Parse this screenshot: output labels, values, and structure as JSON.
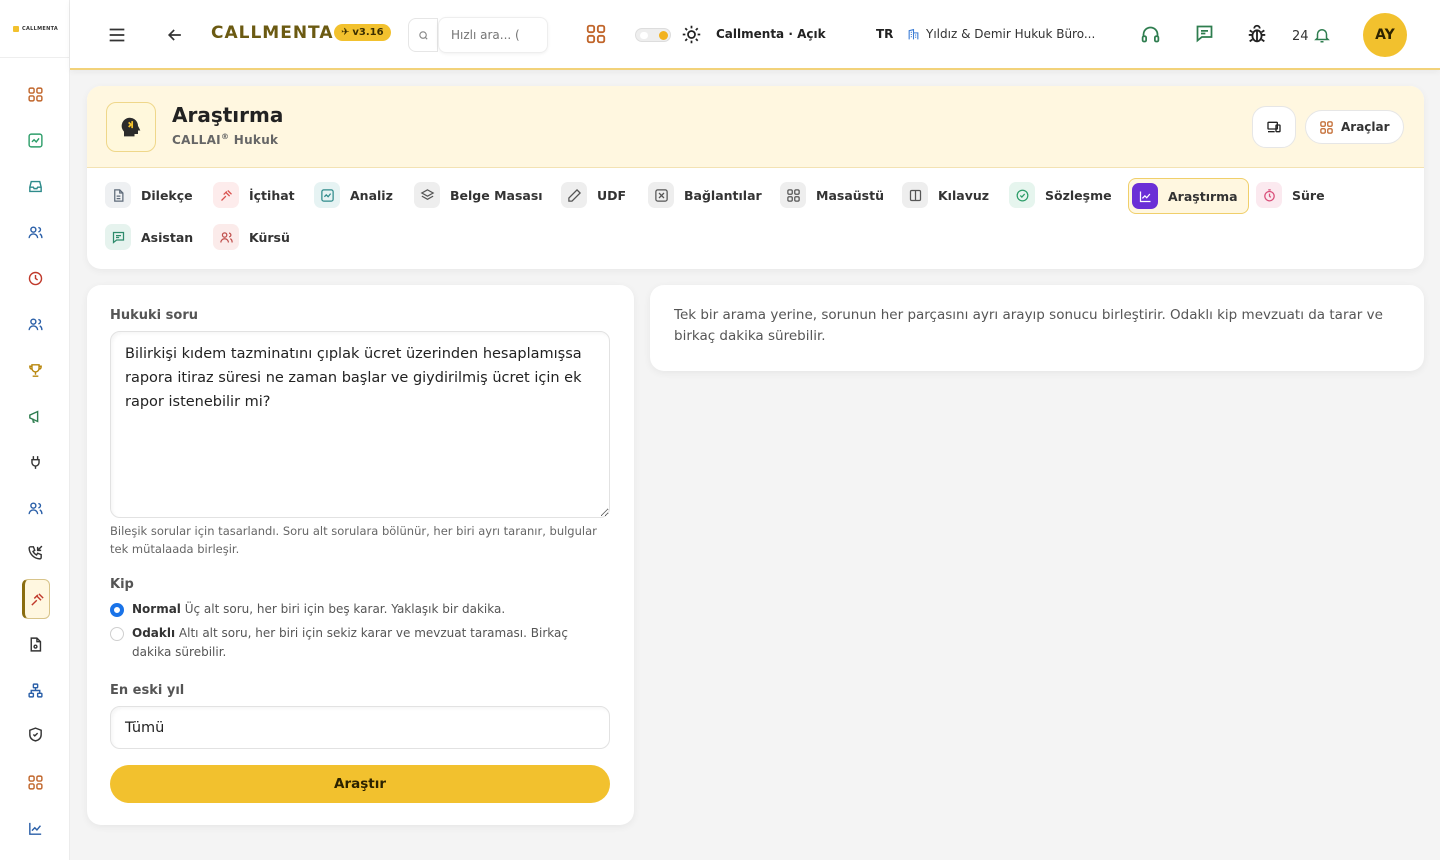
{
  "app": {
    "brand": "CALLMENTA",
    "version": "v3.16",
    "side_logo": "CALLMENTA"
  },
  "topbar": {
    "search_placeholder": "Hızlı ara... (",
    "status": "Callmenta · Açık",
    "lang": "TR",
    "firm": "Yıldız & Demir Hukuk Büro...",
    "notif_count": "24",
    "avatar": "AY"
  },
  "module": {
    "title": "Araştırma",
    "subtitle_prefix": "CALLAI",
    "subtitle_reg": "®",
    "subtitle_suffix": " Hukuk",
    "tools_label": "Araçlar"
  },
  "tabs": [
    {
      "label": "Dilekçe",
      "icon": "document-icon",
      "color": "#5f6b7a"
    },
    {
      "label": "İçtihat",
      "icon": "gavel-icon",
      "color": "#d9534f"
    },
    {
      "label": "Analiz",
      "icon": "analysis-icon",
      "color": "#2e8b8b"
    },
    {
      "label": "Belge Masası",
      "icon": "layers-icon",
      "color": "#555555"
    },
    {
      "label": "UDF",
      "icon": "pen-icon",
      "color": "#555555"
    },
    {
      "label": "Bağlantılar",
      "icon": "link-icon",
      "color": "#555555"
    },
    {
      "label": "Masaüstü",
      "icon": "grid-icon",
      "color": "#555555"
    },
    {
      "label": "Kılavuz",
      "icon": "book-icon",
      "color": "#555555"
    },
    {
      "label": "Sözleşme",
      "icon": "check-badge-icon",
      "color": "#2e9e6a"
    },
    {
      "label": "Araştırma",
      "icon": "chart-line-icon",
      "color": "#ffffff",
      "active": true
    },
    {
      "label": "Süre",
      "icon": "clock-icon",
      "color": "#d94f7a"
    },
    {
      "label": "Asistan",
      "icon": "chat-icon",
      "color": "#2e8b6b"
    },
    {
      "label": "Kürsü",
      "icon": "users-icon",
      "color": "#c0504d"
    }
  ],
  "form": {
    "question_label": "Hukuki soru",
    "question_value": "Bilirkişi kıdem tazminatını çıplak ücret üzerinden hesaplamışsa rapora itiraz süresi ne zaman başlar ve giydirilmiş ücret için ek rapor istenebilir mi?",
    "question_help": "Bileşik sorular için tasarlandı. Soru alt sorulara bölünür, her biri ayrı taranır, bulgular tek mütalaada birleşir.",
    "mode_label": "Kip",
    "modes": [
      {
        "name": "Normal",
        "desc": " Üç alt soru, her biri için beş karar. Yaklaşık bir dakika.",
        "selected": true
      },
      {
        "name": "Odaklı",
        "desc": " Altı alt soru, her biri için sekiz karar ve mevzuat taraması. Birkaç dakika sürebilir.",
        "selected": false
      }
    ],
    "year_label": "En eski yıl",
    "year_value": "Tümü",
    "submit_label": "Araştır"
  },
  "info": {
    "text": "Tek bir arama yerine, sorunun her parçasını ayrı arayıp sonucu birleştirir. Odaklı kip mevzuatı da tarar ve birkaç dakika sürebilir."
  },
  "colors": {
    "accent": "#f2c12e",
    "brand_text": "#6b5a12",
    "active_tab_icon_bg": "#6b2fd6",
    "radio_selected": "#1a73e8"
  }
}
